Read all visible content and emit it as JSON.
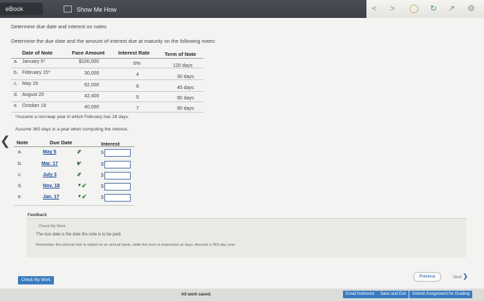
{
  "header": {
    "ebook_tab": "eBook",
    "show_me_how_tab": "Show Me How"
  },
  "toolbar_icons": [
    "back-arrow-icon",
    "forward-arrow-icon",
    "circle-icon",
    "refresh-icon",
    "share-icon",
    "settings-icon"
  ],
  "page_title": "Determine due date and interest on notes",
  "instructions": "Determine the due date and the amount of interest due at maturity on the following notes:",
  "notes_table": {
    "headers": [
      "Date of Note",
      "Face Amount",
      "Interest Rate",
      "Term of Note"
    ],
    "rows": [
      {
        "letter": "a.",
        "date": "January 5*",
        "face": "$100,000",
        "rate": "6%",
        "term": "120 days"
      },
      {
        "letter": "b.",
        "date": "February 15*",
        "face": "30,000",
        "rate": "4",
        "term": "30 days"
      },
      {
        "letter": "c.",
        "date": "May 19",
        "face": "62,000",
        "rate": "8",
        "term": "45 days"
      },
      {
        "letter": "d.",
        "date": "August 20",
        "face": "42,400",
        "rate": "5",
        "term": "90 days"
      },
      {
        "letter": "e.",
        "date": "October 19",
        "face": "40,000",
        "rate": "7",
        "term": "90 days"
      }
    ]
  },
  "footnote": "*Assume a non-leap year in which February has 28 days.",
  "assumption": "Assume 360 days in a year when computing the interest.",
  "answer_table": {
    "headers": [
      "Note",
      "Due Date",
      "Interest"
    ],
    "rows": [
      {
        "letter": "a.",
        "due": "May 5"
      },
      {
        "letter": "b.",
        "due": "Mar. 17"
      },
      {
        "letter": "c.",
        "due": "July 3"
      },
      {
        "letter": "d.",
        "due": "Nov. 18"
      },
      {
        "letter": "e.",
        "due": "Jan. 17"
      }
    ],
    "currency_symbol": "$"
  },
  "feedback": {
    "label": "Feedback",
    "check_my_work": "Check My Work",
    "line1": "The due date is the date the note is to be paid.",
    "line2": "Remember the interest rate is stated on an annual basis, while the term is expressed as days. Assume a 360-day year."
  },
  "buttons": {
    "check_my_work": "Check My Work",
    "previous": "Previous",
    "next": "Next",
    "email_instructor": "Email Instructor",
    "save_and_exit": "Save and Exit",
    "submit": "Submit Assignment for Grading"
  },
  "status": "All work saved."
}
